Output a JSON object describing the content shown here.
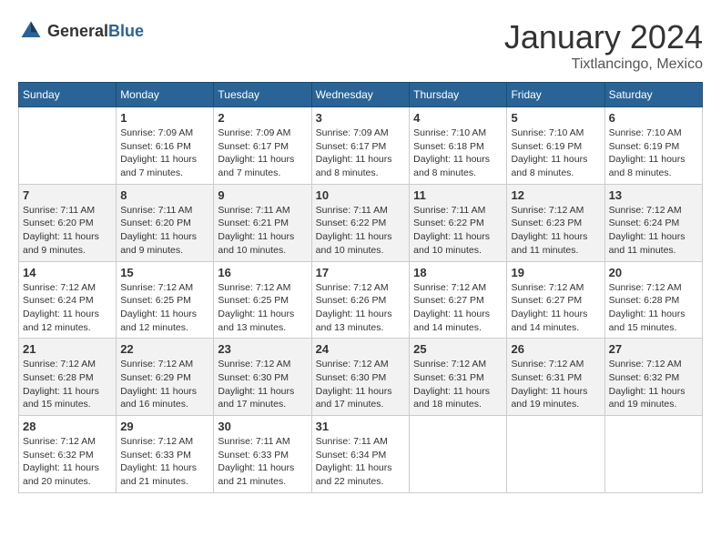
{
  "header": {
    "logo_general": "General",
    "logo_blue": "Blue",
    "month_title": "January 2024",
    "location": "Tixtlancingo, Mexico"
  },
  "days_of_week": [
    "Sunday",
    "Monday",
    "Tuesday",
    "Wednesday",
    "Thursday",
    "Friday",
    "Saturday"
  ],
  "weeks": [
    [
      {
        "day": "",
        "sunrise": "",
        "sunset": "",
        "daylight": ""
      },
      {
        "day": "1",
        "sunrise": "Sunrise: 7:09 AM",
        "sunset": "Sunset: 6:16 PM",
        "daylight": "Daylight: 11 hours and 7 minutes."
      },
      {
        "day": "2",
        "sunrise": "Sunrise: 7:09 AM",
        "sunset": "Sunset: 6:17 PM",
        "daylight": "Daylight: 11 hours and 7 minutes."
      },
      {
        "day": "3",
        "sunrise": "Sunrise: 7:09 AM",
        "sunset": "Sunset: 6:17 PM",
        "daylight": "Daylight: 11 hours and 8 minutes."
      },
      {
        "day": "4",
        "sunrise": "Sunrise: 7:10 AM",
        "sunset": "Sunset: 6:18 PM",
        "daylight": "Daylight: 11 hours and 8 minutes."
      },
      {
        "day": "5",
        "sunrise": "Sunrise: 7:10 AM",
        "sunset": "Sunset: 6:19 PM",
        "daylight": "Daylight: 11 hours and 8 minutes."
      },
      {
        "day": "6",
        "sunrise": "Sunrise: 7:10 AM",
        "sunset": "Sunset: 6:19 PM",
        "daylight": "Daylight: 11 hours and 8 minutes."
      }
    ],
    [
      {
        "day": "7",
        "sunrise": "Sunrise: 7:11 AM",
        "sunset": "Sunset: 6:20 PM",
        "daylight": "Daylight: 11 hours and 9 minutes."
      },
      {
        "day": "8",
        "sunrise": "Sunrise: 7:11 AM",
        "sunset": "Sunset: 6:20 PM",
        "daylight": "Daylight: 11 hours and 9 minutes."
      },
      {
        "day": "9",
        "sunrise": "Sunrise: 7:11 AM",
        "sunset": "Sunset: 6:21 PM",
        "daylight": "Daylight: 11 hours and 10 minutes."
      },
      {
        "day": "10",
        "sunrise": "Sunrise: 7:11 AM",
        "sunset": "Sunset: 6:22 PM",
        "daylight": "Daylight: 11 hours and 10 minutes."
      },
      {
        "day": "11",
        "sunrise": "Sunrise: 7:11 AM",
        "sunset": "Sunset: 6:22 PM",
        "daylight": "Daylight: 11 hours and 10 minutes."
      },
      {
        "day": "12",
        "sunrise": "Sunrise: 7:12 AM",
        "sunset": "Sunset: 6:23 PM",
        "daylight": "Daylight: 11 hours and 11 minutes."
      },
      {
        "day": "13",
        "sunrise": "Sunrise: 7:12 AM",
        "sunset": "Sunset: 6:24 PM",
        "daylight": "Daylight: 11 hours and 11 minutes."
      }
    ],
    [
      {
        "day": "14",
        "sunrise": "Sunrise: 7:12 AM",
        "sunset": "Sunset: 6:24 PM",
        "daylight": "Daylight: 11 hours and 12 minutes."
      },
      {
        "day": "15",
        "sunrise": "Sunrise: 7:12 AM",
        "sunset": "Sunset: 6:25 PM",
        "daylight": "Daylight: 11 hours and 12 minutes."
      },
      {
        "day": "16",
        "sunrise": "Sunrise: 7:12 AM",
        "sunset": "Sunset: 6:25 PM",
        "daylight": "Daylight: 11 hours and 13 minutes."
      },
      {
        "day": "17",
        "sunrise": "Sunrise: 7:12 AM",
        "sunset": "Sunset: 6:26 PM",
        "daylight": "Daylight: 11 hours and 13 minutes."
      },
      {
        "day": "18",
        "sunrise": "Sunrise: 7:12 AM",
        "sunset": "Sunset: 6:27 PM",
        "daylight": "Daylight: 11 hours and 14 minutes."
      },
      {
        "day": "19",
        "sunrise": "Sunrise: 7:12 AM",
        "sunset": "Sunset: 6:27 PM",
        "daylight": "Daylight: 11 hours and 14 minutes."
      },
      {
        "day": "20",
        "sunrise": "Sunrise: 7:12 AM",
        "sunset": "Sunset: 6:28 PM",
        "daylight": "Daylight: 11 hours and 15 minutes."
      }
    ],
    [
      {
        "day": "21",
        "sunrise": "Sunrise: 7:12 AM",
        "sunset": "Sunset: 6:28 PM",
        "daylight": "Daylight: 11 hours and 15 minutes."
      },
      {
        "day": "22",
        "sunrise": "Sunrise: 7:12 AM",
        "sunset": "Sunset: 6:29 PM",
        "daylight": "Daylight: 11 hours and 16 minutes."
      },
      {
        "day": "23",
        "sunrise": "Sunrise: 7:12 AM",
        "sunset": "Sunset: 6:30 PM",
        "daylight": "Daylight: 11 hours and 17 minutes."
      },
      {
        "day": "24",
        "sunrise": "Sunrise: 7:12 AM",
        "sunset": "Sunset: 6:30 PM",
        "daylight": "Daylight: 11 hours and 17 minutes."
      },
      {
        "day": "25",
        "sunrise": "Sunrise: 7:12 AM",
        "sunset": "Sunset: 6:31 PM",
        "daylight": "Daylight: 11 hours and 18 minutes."
      },
      {
        "day": "26",
        "sunrise": "Sunrise: 7:12 AM",
        "sunset": "Sunset: 6:31 PM",
        "daylight": "Daylight: 11 hours and 19 minutes."
      },
      {
        "day": "27",
        "sunrise": "Sunrise: 7:12 AM",
        "sunset": "Sunset: 6:32 PM",
        "daylight": "Daylight: 11 hours and 19 minutes."
      }
    ],
    [
      {
        "day": "28",
        "sunrise": "Sunrise: 7:12 AM",
        "sunset": "Sunset: 6:32 PM",
        "daylight": "Daylight: 11 hours and 20 minutes."
      },
      {
        "day": "29",
        "sunrise": "Sunrise: 7:12 AM",
        "sunset": "Sunset: 6:33 PM",
        "daylight": "Daylight: 11 hours and 21 minutes."
      },
      {
        "day": "30",
        "sunrise": "Sunrise: 7:11 AM",
        "sunset": "Sunset: 6:33 PM",
        "daylight": "Daylight: 11 hours and 21 minutes."
      },
      {
        "day": "31",
        "sunrise": "Sunrise: 7:11 AM",
        "sunset": "Sunset: 6:34 PM",
        "daylight": "Daylight: 11 hours and 22 minutes."
      },
      {
        "day": "",
        "sunrise": "",
        "sunset": "",
        "daylight": ""
      },
      {
        "day": "",
        "sunrise": "",
        "sunset": "",
        "daylight": ""
      },
      {
        "day": "",
        "sunrise": "",
        "sunset": "",
        "daylight": ""
      }
    ]
  ]
}
